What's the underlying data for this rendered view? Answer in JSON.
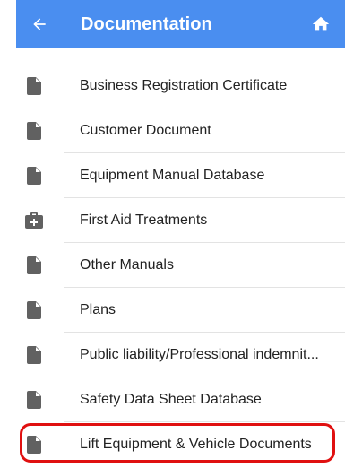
{
  "header": {
    "title": "Documentation",
    "back_icon": "arrow-left-icon",
    "home_icon": "home-icon",
    "background_color": "#4a8ef0"
  },
  "list": {
    "items": [
      {
        "label": "Business Registration Certificate",
        "icon": "document-icon"
      },
      {
        "label": "Customer Document",
        "icon": "document-icon"
      },
      {
        "label": "Equipment Manual Database",
        "icon": "document-icon"
      },
      {
        "label": "First Aid Treatments",
        "icon": "first-aid-kit-icon"
      },
      {
        "label": "Other Manuals",
        "icon": "document-icon"
      },
      {
        "label": "Plans",
        "icon": "document-icon"
      },
      {
        "label": "Public liability/Professional indemnit...",
        "icon": "document-icon"
      },
      {
        "label": "Safety Data Sheet Database",
        "icon": "document-icon"
      },
      {
        "label": "Lift Equipment & Vehicle Documents",
        "icon": "document-icon"
      }
    ]
  },
  "colors": {
    "icon_gray": "#616161",
    "highlight_red": "#e01010"
  }
}
